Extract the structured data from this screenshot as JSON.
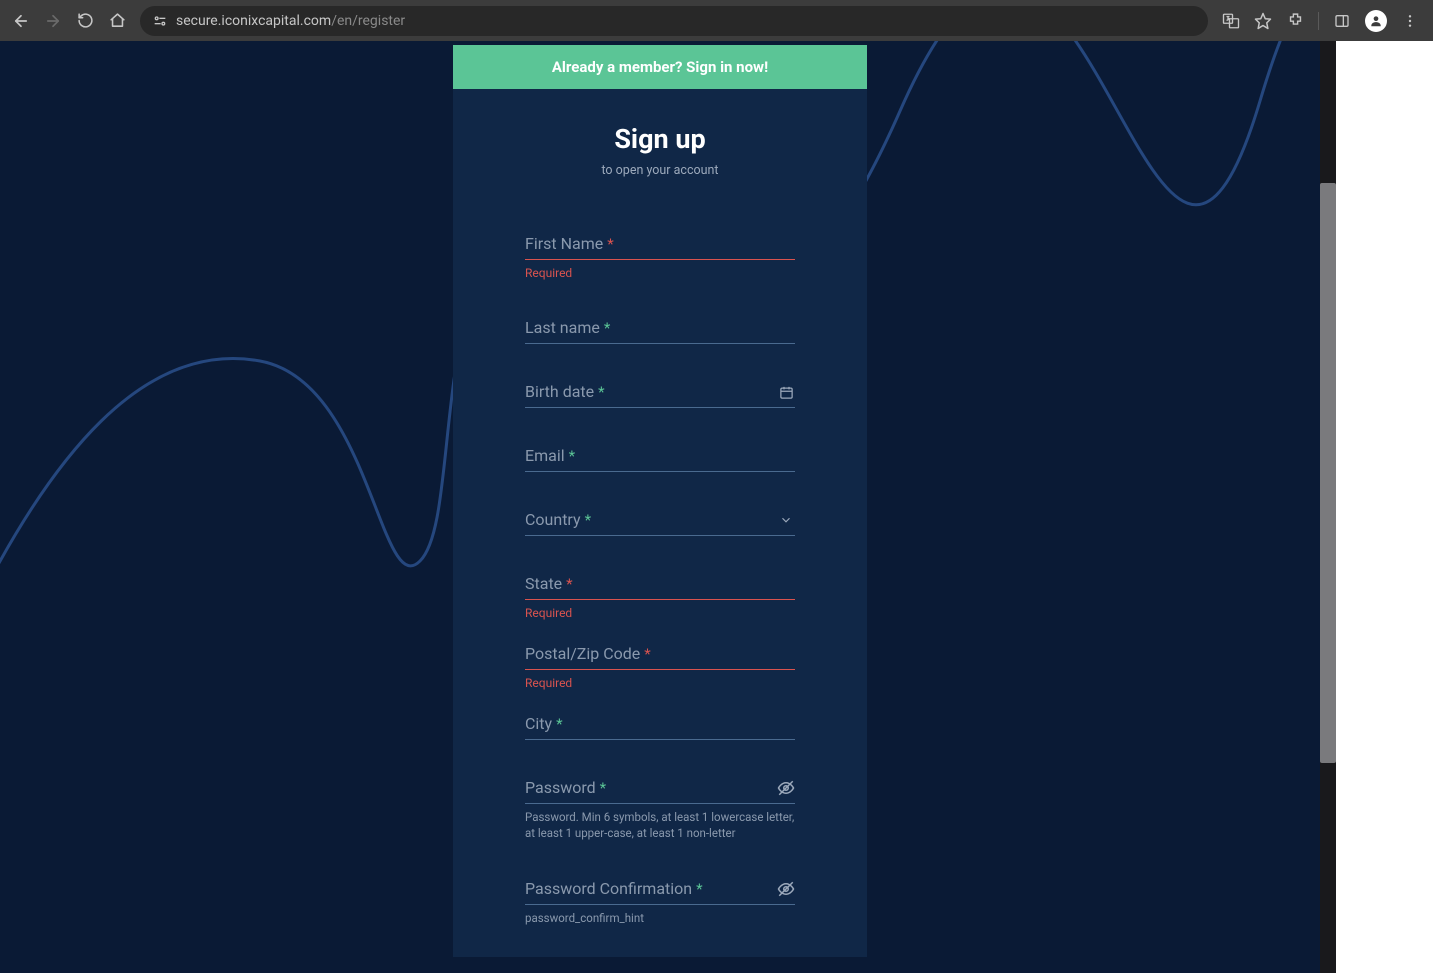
{
  "browser": {
    "url_host": "secure.iconixcapital.com",
    "url_path": "/en/register"
  },
  "banner": {
    "text": "Already a member? Sign in now!"
  },
  "header": {
    "title": "Sign up",
    "subtitle": "to open your account"
  },
  "fields": {
    "first_name": {
      "label": "First Name",
      "error": "Required"
    },
    "last_name": {
      "label": "Last name"
    },
    "birth_date": {
      "label": "Birth date"
    },
    "email": {
      "label": "Email"
    },
    "country": {
      "label": "Country"
    },
    "state": {
      "label": "State",
      "error": "Required"
    },
    "postal": {
      "label": "Postal/Zip Code",
      "error": "Required"
    },
    "city": {
      "label": "City"
    },
    "password": {
      "label": "Password",
      "help": "Password. Min 6 symbols, at least 1 lowercase letter, at least 1 upper-case, at least 1 non-letter"
    },
    "password_confirm": {
      "label": "Password Confirmation",
      "help": "password_confirm_hint"
    }
  }
}
